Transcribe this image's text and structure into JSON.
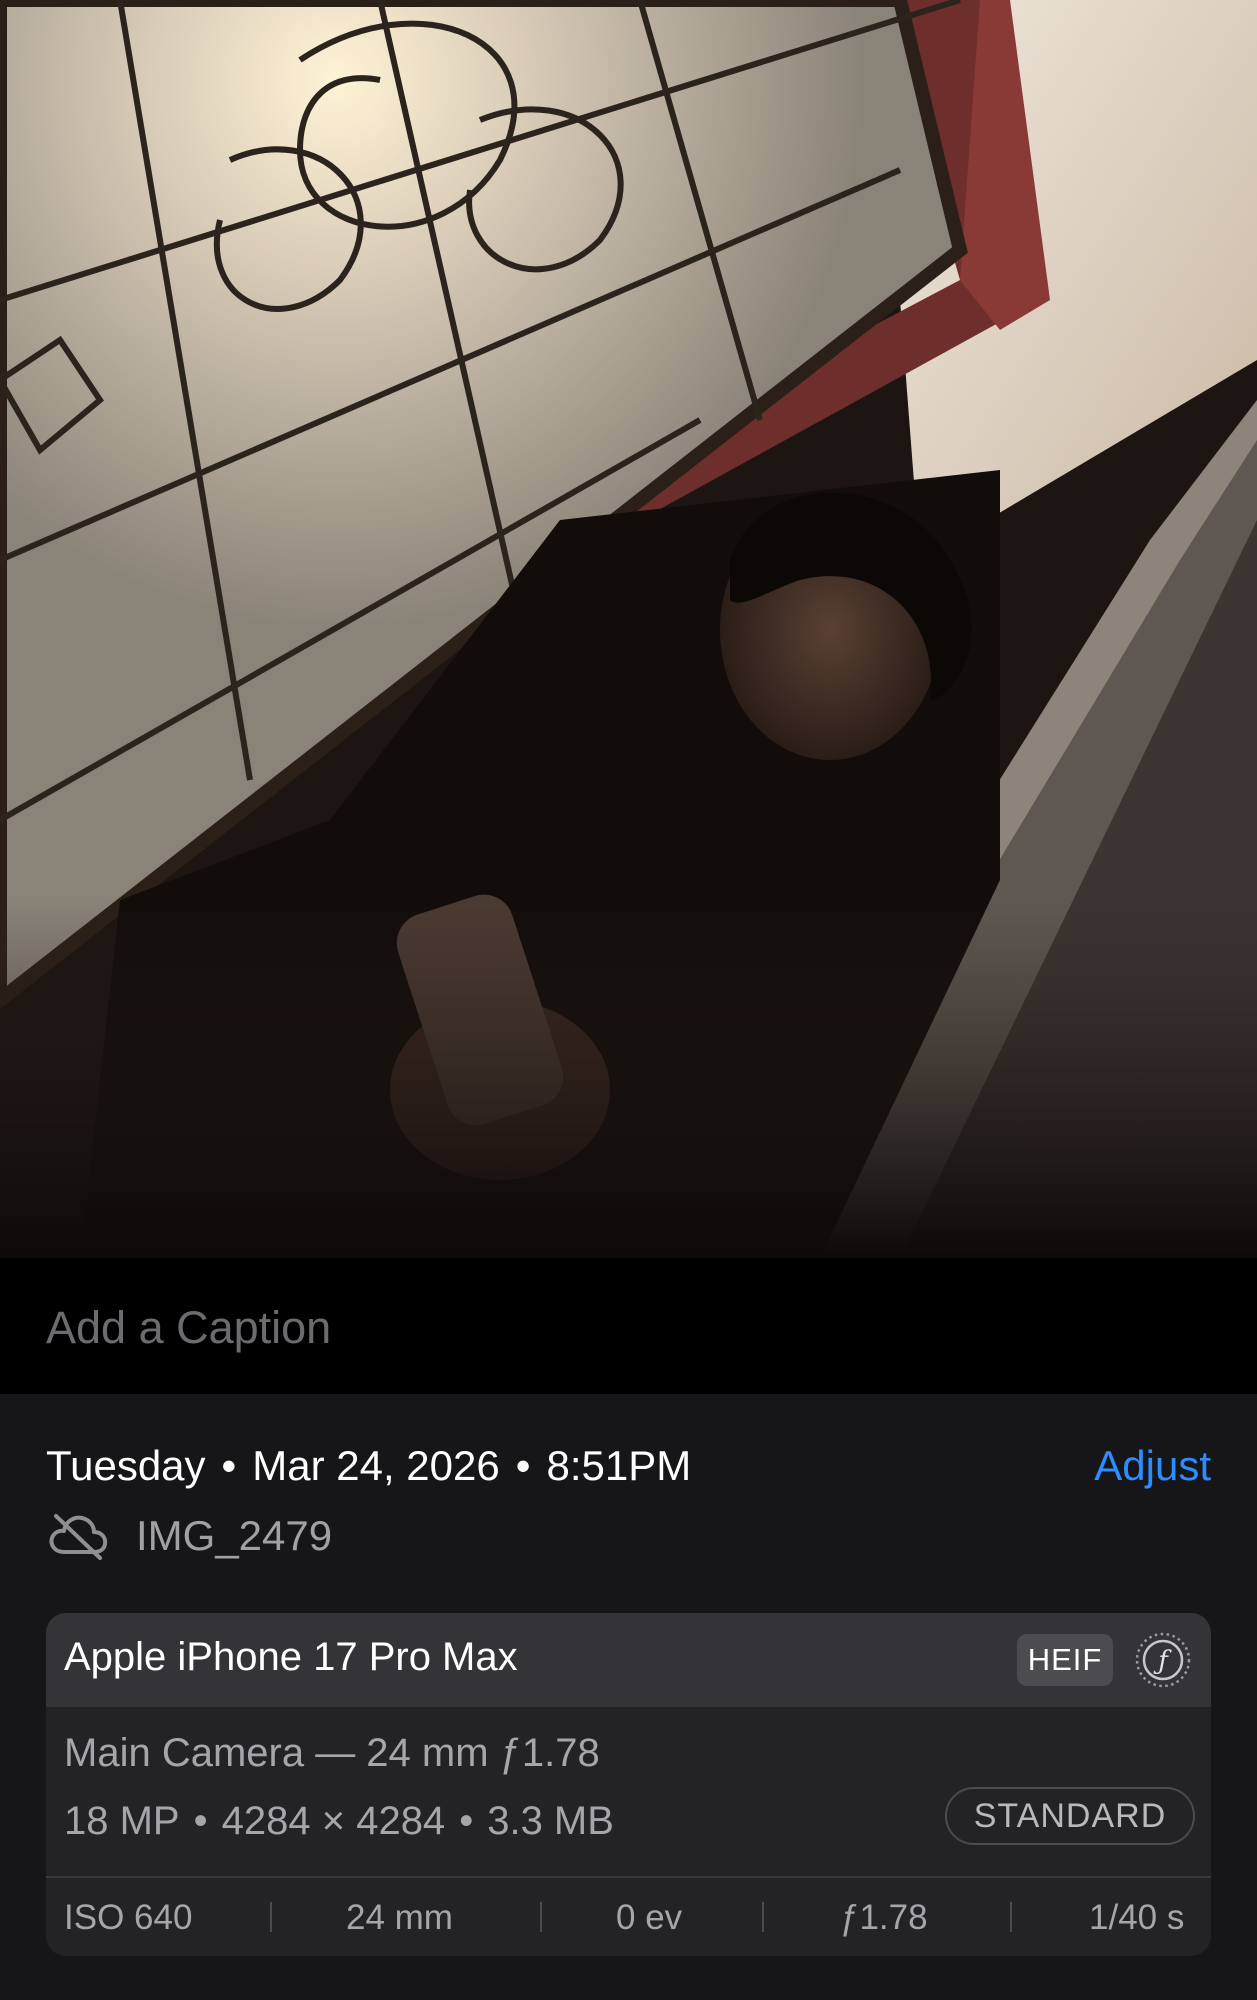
{
  "photo": {
    "description_icon": "photo-image"
  },
  "caption": {
    "placeholder": "Add a Caption",
    "value": ""
  },
  "info": {
    "day": "Tuesday",
    "date": "Mar 24, 2026",
    "time": "8:51PM",
    "separator": "•",
    "adjust_label": "Adjust",
    "cloud_icon": "cloud-off-icon",
    "file_name": "IMG_2479"
  },
  "meta": {
    "device": "Apple iPhone 17 Pro Max",
    "format": "HEIF",
    "filter_icon": "photographic-style-icon",
    "lens": "Main Camera — 24 mm ƒ1.78",
    "megapixels": "18 MP",
    "dimensions": "4284 × 4284",
    "size": "3.3 MB",
    "separator": "•",
    "style": "STANDARD",
    "exif": {
      "iso": "ISO 640",
      "focal_length": "24 mm",
      "exposure_value": "0 ev",
      "aperture": "ƒ1.78",
      "shutter": "1/40 s"
    }
  },
  "colors": {
    "accent": "#2d8cff",
    "panel": "#161618",
    "card": "#232326",
    "card_header": "#343438",
    "secondary_text": "#a5a5ab"
  }
}
